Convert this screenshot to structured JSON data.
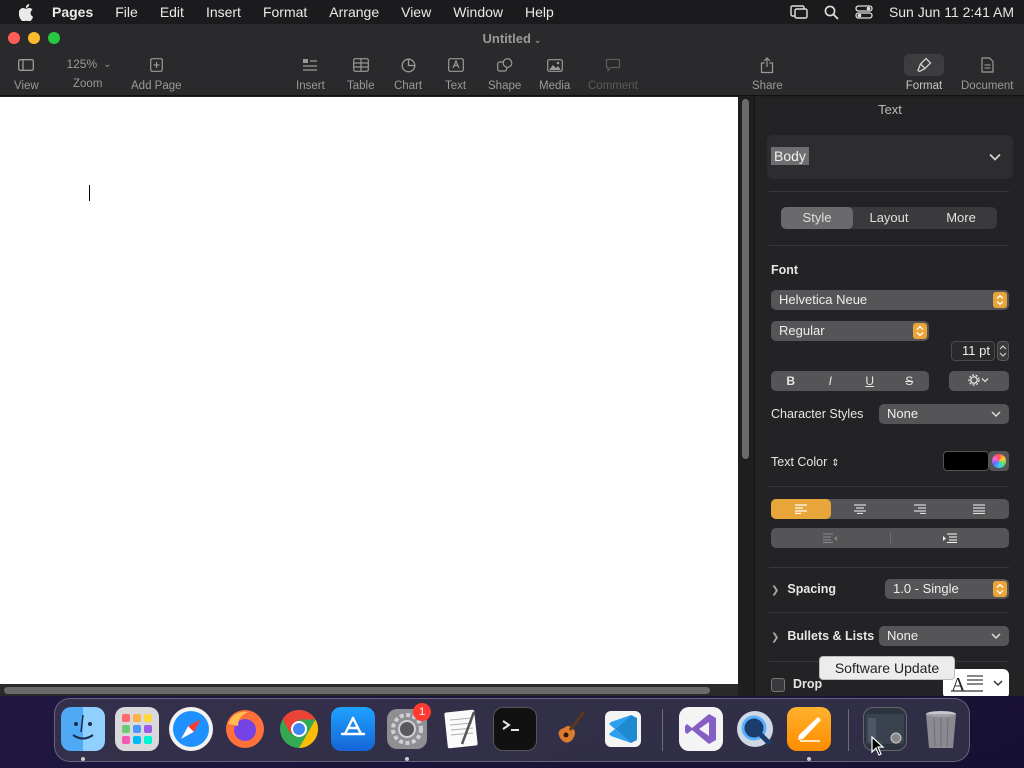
{
  "menubar": {
    "app": "Pages",
    "items": [
      "File",
      "Edit",
      "Insert",
      "Format",
      "Arrange",
      "View",
      "Window",
      "Help"
    ],
    "clock": "Sun Jun 11  2:41 AM"
  },
  "window": {
    "title": "Untitled",
    "toolbar": {
      "view": "View",
      "zoom_value": "125%",
      "zoom": "Zoom",
      "add_page": "Add Page",
      "insert": "Insert",
      "table": "Table",
      "chart": "Chart",
      "text": "Text",
      "shape": "Shape",
      "media": "Media",
      "comment": "Comment",
      "share": "Share",
      "format": "Format",
      "document": "Document"
    }
  },
  "inspector": {
    "title": "Text",
    "paragraph_style": "Body",
    "tabs": [
      "Style",
      "Layout",
      "More"
    ],
    "selected_tab": "Style",
    "font_label": "Font",
    "font_family": "Helvetica Neue",
    "font_typeface": "Regular",
    "font_size": "11 pt",
    "style_buttons": [
      "B",
      "I",
      "U",
      "S"
    ],
    "character_styles_label": "Character Styles",
    "character_styles_value": "None",
    "text_color_label": "Text Color",
    "text_color": "#000000",
    "alignment_selected": "left",
    "spacing_label": "Spacing",
    "spacing_value": "1.0 - Single",
    "bullets_label": "Bullets & Lists",
    "bullets_value": "None",
    "drop_cap_label": "Drop",
    "accent_color": "#e8a63a"
  },
  "tooltip": "Software Update",
  "dock": {
    "apps": [
      "Finder",
      "Launchpad",
      "Safari",
      "Firefox",
      "Chrome",
      "App Store",
      "System Settings",
      "TextEdit",
      "Terminal",
      "GarageBand",
      "Visual Studio Code",
      "Visual Studio",
      "QuickTime Player",
      "Pages",
      "Software Update",
      "Trash"
    ],
    "settings_badge": "1"
  }
}
